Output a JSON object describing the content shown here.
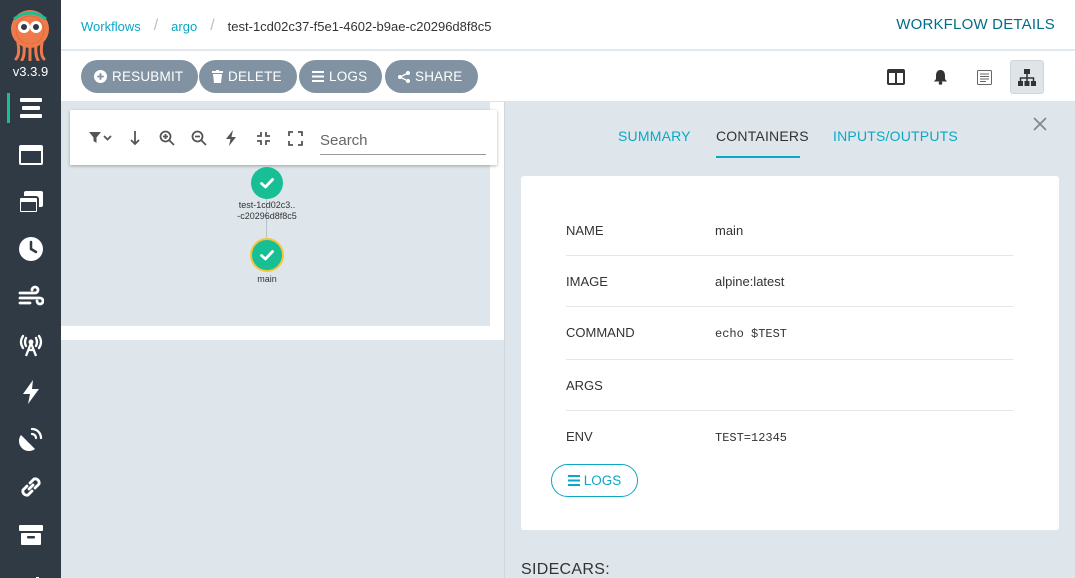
{
  "app": {
    "version": "v3.3.9"
  },
  "nav": {
    "items": [
      {
        "id": "workflows",
        "icon": "workflows-icon",
        "active": true
      },
      {
        "id": "workflow-templates",
        "icon": "window-icon"
      },
      {
        "id": "cluster-workflow-templates",
        "icon": "window-stack-icon"
      },
      {
        "id": "cron-workflows",
        "icon": "clock-icon"
      },
      {
        "id": "event-flow",
        "icon": "wind-icon"
      },
      {
        "id": "event-sources",
        "icon": "broadcast-tower-icon"
      },
      {
        "id": "sensors",
        "icon": "bolt-icon"
      },
      {
        "id": "event-bus",
        "icon": "satellite-dish-icon"
      },
      {
        "id": "links",
        "icon": "link-icon"
      },
      {
        "id": "archived-workflows",
        "icon": "archive-icon"
      },
      {
        "id": "reports",
        "icon": "chart-icon"
      }
    ]
  },
  "breadcrumbs": {
    "workflows": "Workflows",
    "namespace": "argo",
    "current": "test-1cd02c37-f5e1-4602-b9ae-c20296d8f8c5"
  },
  "header": {
    "title": "WORKFLOW DETAILS"
  },
  "toolbar": {
    "resubmit": "RESUBMIT",
    "delete": "DELETE",
    "logs": "LOGS",
    "share": "SHARE"
  },
  "graph": {
    "search_placeholder": "Search",
    "nodes": [
      {
        "label_line1": "test-1cd02c3..",
        "label_line2": "-c20296d8f8c5",
        "status": "succeeded"
      },
      {
        "label_line1": "main",
        "status": "succeeded",
        "selected": true
      }
    ]
  },
  "details": {
    "tabs": {
      "summary": "SUMMARY",
      "containers": "CONTAINERS",
      "inputs_outputs": "INPUTS/OUTPUTS"
    },
    "active_tab": "CONTAINERS",
    "fields": [
      {
        "key": "NAME",
        "value": "main"
      },
      {
        "key": "IMAGE",
        "value": "alpine:latest"
      },
      {
        "key": "COMMAND",
        "value": "echo $TEST"
      },
      {
        "key": "ARGS",
        "value": ""
      },
      {
        "key": "ENV",
        "value": "TEST=12345"
      }
    ],
    "logs_button": "LOGS",
    "sidecars_heading": "SIDECARS:"
  },
  "colors": {
    "accent": "#0aa8c4",
    "success": "#18be94",
    "nav_bg": "#2f3a44",
    "button_bg": "#8193a2",
    "title": "#016d87"
  }
}
